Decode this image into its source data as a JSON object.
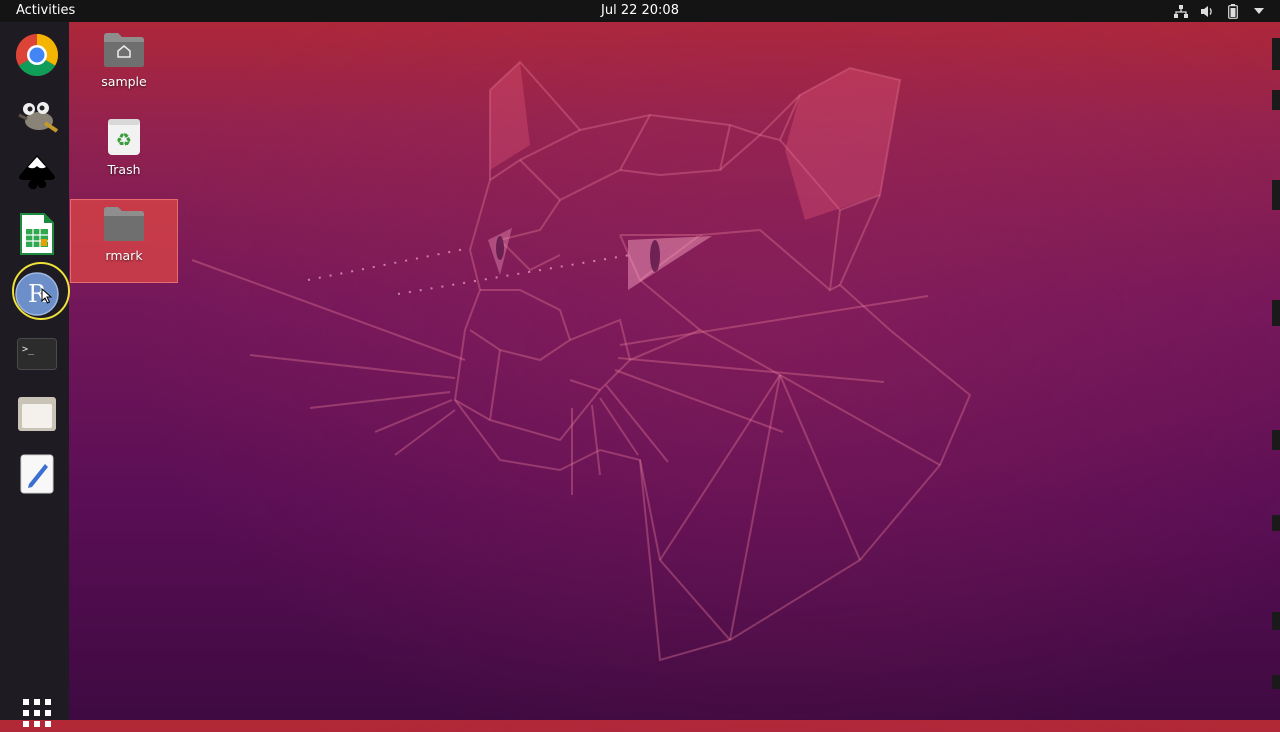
{
  "topbar": {
    "activities_label": "Activities",
    "clock": "Jul 22  20:08",
    "tray_icons": [
      "network-icon",
      "volume-icon",
      "battery-icon",
      "system-menu-chevron-icon"
    ]
  },
  "dock": {
    "items": [
      {
        "name": "Google Chrome",
        "icon": "chrome-icon"
      },
      {
        "name": "GIMP",
        "icon": "gimp-icon"
      },
      {
        "name": "Inkscape",
        "icon": "inkscape-icon"
      },
      {
        "name": "LibreOffice Calc",
        "icon": "calc-icon"
      },
      {
        "name": "R",
        "icon": "r-icon",
        "letter": "R"
      },
      {
        "name": "Terminal",
        "icon": "terminal-icon",
        "prompt": ">_"
      },
      {
        "name": "Files",
        "icon": "files-icon"
      },
      {
        "name": "Text Editor",
        "icon": "text-editor-icon"
      }
    ],
    "show_apps_icon": "apps-grid-icon"
  },
  "desktop": {
    "icons": [
      {
        "label": "sample",
        "icon": "home-folder-icon"
      },
      {
        "label": "Trash",
        "icon": "trash-icon"
      },
      {
        "label": "rmark",
        "icon": "folder-icon",
        "selected": true
      }
    ]
  },
  "colors": {
    "topbar": "#141414",
    "dock": "#1f1b22",
    "wallpaper_top": "#b32835",
    "wallpaper_bottom": "#3e0a41",
    "selection": "#de4646",
    "cursor_ring": "#ede13a"
  }
}
